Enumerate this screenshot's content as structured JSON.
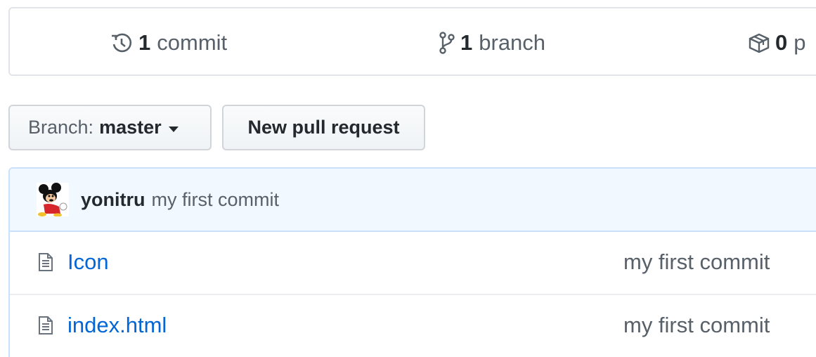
{
  "summary": {
    "commits": {
      "count": "1",
      "label": "commit",
      "icon": "history-icon"
    },
    "branches": {
      "count": "1",
      "label": "branch",
      "icon": "git-branch-icon"
    },
    "packages": {
      "count": "0",
      "label": "p",
      "icon": "package-icon"
    }
  },
  "toolbar": {
    "branch_prefix": "Branch:",
    "branch_name": "master",
    "new_pr_label": "New pull request"
  },
  "latest_commit": {
    "author": "yonitru",
    "message": "my first commit"
  },
  "files": [
    {
      "name": "Icon",
      "message": "my first commit",
      "icon": "file-icon"
    },
    {
      "name": "index.html",
      "message": "my first commit",
      "icon": "file-icon"
    }
  ],
  "colors": {
    "link": "#0366d6",
    "muted": "#586069",
    "tease_bg": "#f1f8ff",
    "tease_border": "#c8e1ff"
  }
}
